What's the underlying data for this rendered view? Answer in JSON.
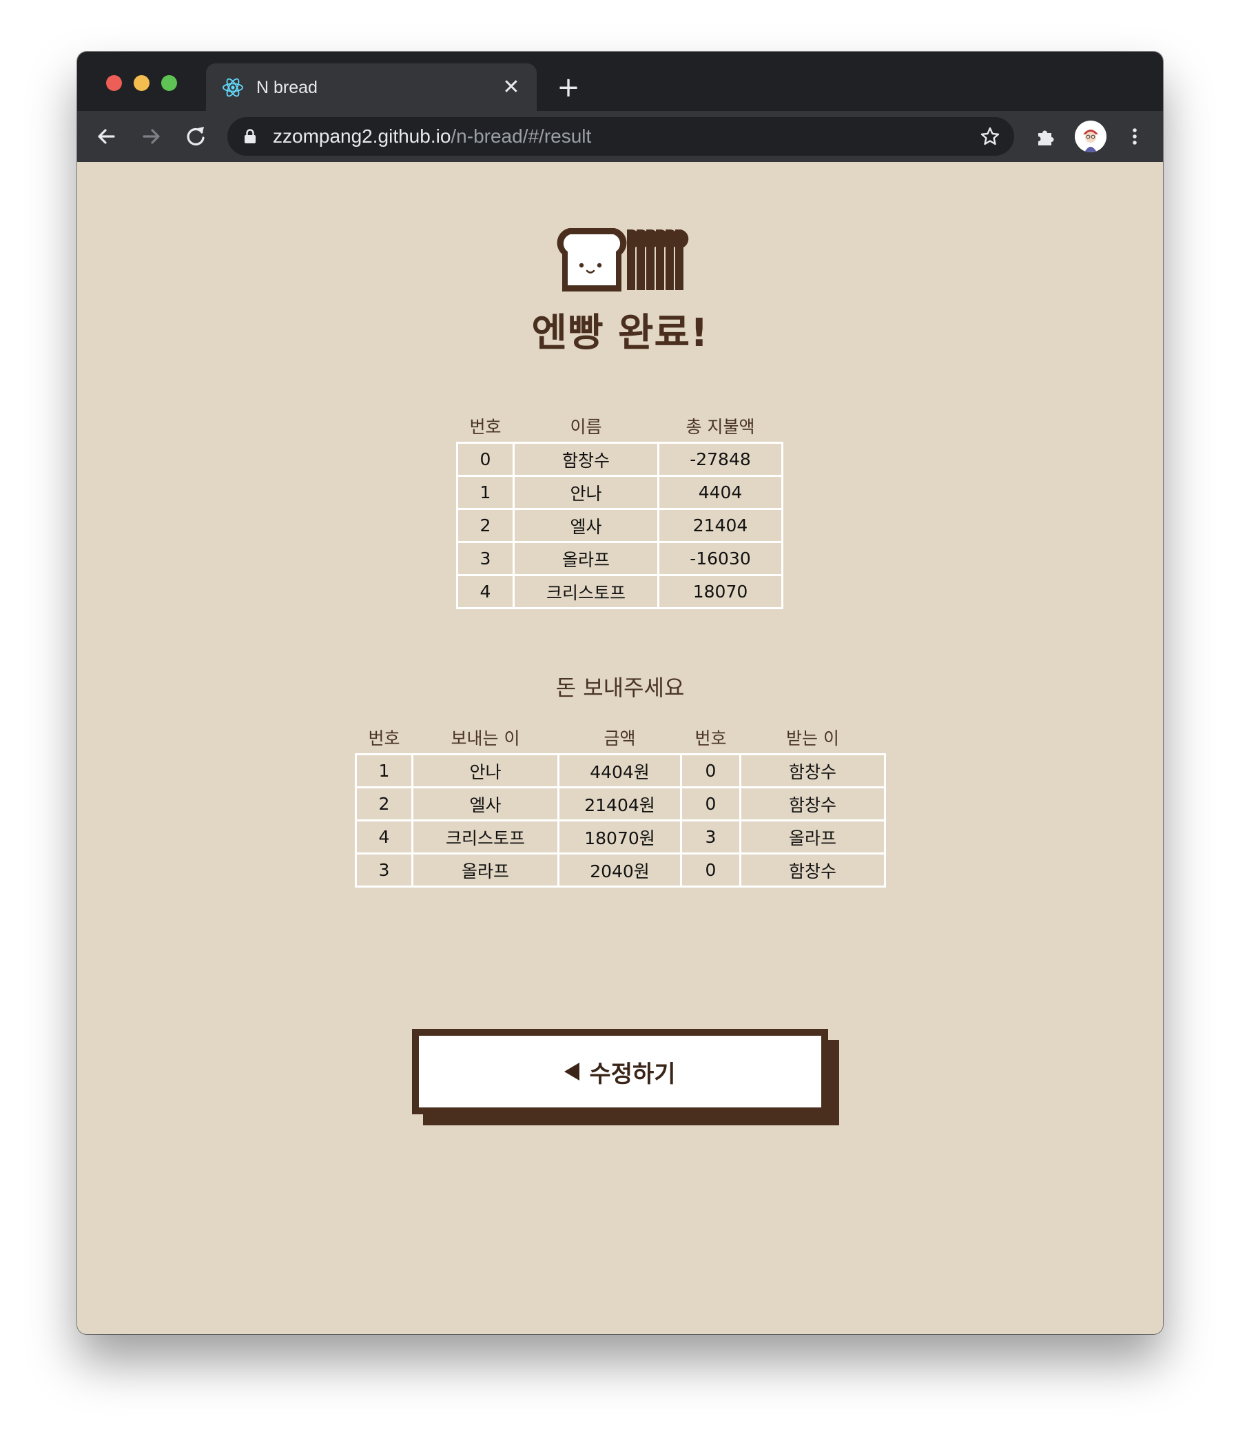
{
  "browser": {
    "tab_title": "N bread",
    "url_host": "zzompang2.github.io",
    "url_path": "/n-bread/#/result"
  },
  "page": {
    "title": "엔빵 완료!",
    "summary_table": {
      "headers": [
        "번호",
        "이름",
        "총 지불액"
      ],
      "rows": [
        [
          "0",
          "함창수",
          "-27848"
        ],
        [
          "1",
          "안나",
          "4404"
        ],
        [
          "2",
          "엘사",
          "21404"
        ],
        [
          "3",
          "올라프",
          "-16030"
        ],
        [
          "4",
          "크리스토프",
          "18070"
        ]
      ]
    },
    "send_title": "돈 보내주세요",
    "transfer_table": {
      "headers": [
        "번호",
        "보내는 이",
        "금액",
        "번호",
        "받는 이"
      ],
      "rows": [
        [
          "1",
          "안나",
          "4404원",
          "0",
          "함창수"
        ],
        [
          "2",
          "엘사",
          "21404원",
          "0",
          "함창수"
        ],
        [
          "4",
          "크리스토프",
          "18070원",
          "3",
          "올라프"
        ],
        [
          "3",
          "올라프",
          "2040원",
          "0",
          "함창수"
        ]
      ]
    },
    "edit_button_label": "수정하기"
  },
  "colors": {
    "background": "#e2d7c5",
    "brown": "#4a2f1f",
    "chrome_dark": "#202124",
    "chrome_mid": "#35363a"
  }
}
